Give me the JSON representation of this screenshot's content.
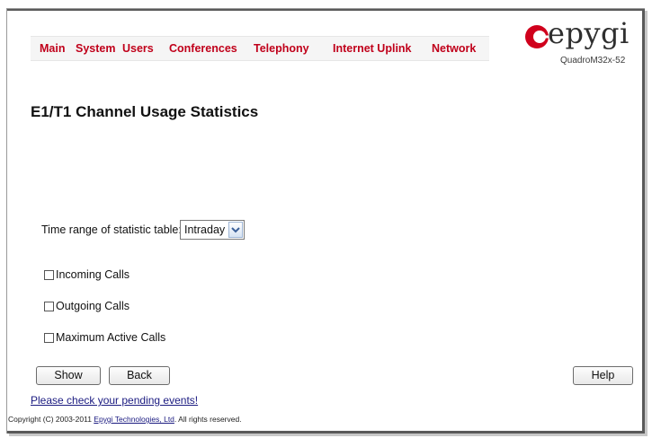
{
  "menu": {
    "items": [
      {
        "label": "Main"
      },
      {
        "label": "System"
      },
      {
        "label": "Users"
      },
      {
        "label": "Conferences"
      },
      {
        "label": "Telephony"
      },
      {
        "label": "Internet Uplink"
      },
      {
        "label": "Network"
      }
    ]
  },
  "logo": {
    "text": "epygi",
    "model": "QuadroM32x-52",
    "icon": "epygi-logo-icon"
  },
  "page": {
    "title": "E1/T1 Channel Usage Statistics"
  },
  "time_range": {
    "label": "Time range of statistic table:",
    "selected": "Intraday",
    "icon": "chevron-down-icon"
  },
  "options": [
    {
      "label": "Incoming Calls",
      "checked": false
    },
    {
      "label": "Outgoing Calls",
      "checked": false
    },
    {
      "label": "Maximum Active Calls",
      "checked": false
    }
  ],
  "buttons": {
    "show": "Show",
    "back": "Back",
    "help": "Help"
  },
  "footer": {
    "pending_link": "Please check your pending events!",
    "copyright_prefix": "Copyright (C) 2003-2011 ",
    "company_link": "Epygi Technologies, Ltd",
    "copyright_suffix": ". All rights reserved."
  },
  "colors": {
    "menu_text": "#c0001a",
    "logo_red": "#d0001c",
    "link": "#1a1a80"
  }
}
